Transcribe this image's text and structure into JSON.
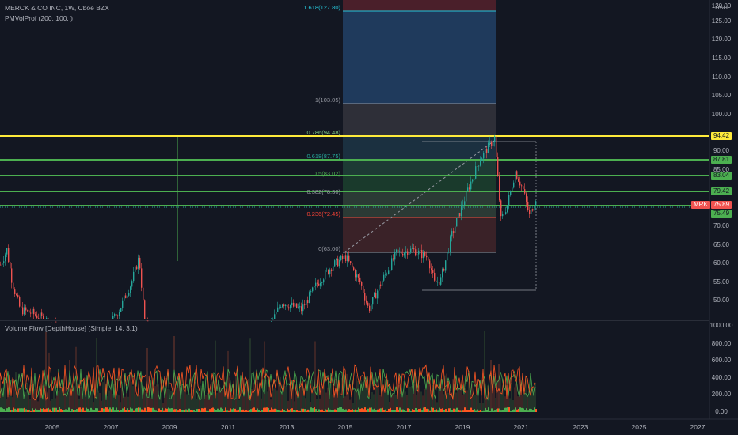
{
  "header": {
    "title": "MERCK & CO INC, 1W, Cboe BZX",
    "indicator": "PMVolProf (200, 100, )",
    "currency": "USD",
    "lower_indicator": "Volume Flow [DepthHouse] (Simple, 14, 3.1)"
  },
  "colors": {
    "background": "#131722",
    "up": "#26a69a",
    "down": "#ef5350",
    "yellow_line": "#ffeb3b",
    "green_line": "#4caf50"
  },
  "price_axis": [
    "120.00",
    "125.00",
    "115.00",
    "110.00",
    "105.00",
    "100.00",
    "90.00",
    "85.00",
    "70.00",
    "65.00",
    "60.00",
    "55.00",
    "50.00"
  ],
  "volume_axis": [
    "1000.00",
    "800.00",
    "600.00",
    "400.00",
    "200.00",
    "0.00"
  ],
  "time_axis": [
    "2005",
    "2007",
    "2009",
    "2011",
    "2013",
    "2015",
    "2017",
    "2019",
    "2021",
    "2023",
    "2025",
    "2027"
  ],
  "fib_levels": [
    {
      "label": "1.618(127.80)",
      "price": 127.8,
      "color": "#26c6da"
    },
    {
      "label": "1(103.05)",
      "price": 103.05,
      "color": "#9598a1"
    },
    {
      "label": "0.786(94.48)",
      "price": 94.48,
      "color": "#81c784"
    },
    {
      "label": "0.618(87.75)",
      "price": 87.75,
      "color": "#26a69a"
    },
    {
      "label": "0.5(83.02)",
      "price": 83.02,
      "color": "#4caf50"
    },
    {
      "label": "0.382(78.30)",
      "price": 78.3,
      "color": "#9598a1"
    },
    {
      "label": "0.236(72.45)",
      "price": 72.45,
      "color": "#f44336"
    },
    {
      "label": "0(63.00)",
      "price": 63.0,
      "color": "#9598a1"
    }
  ],
  "horizontal_lines": [
    {
      "price": 94.42,
      "label": "94.42",
      "color": "#ffeb3b"
    },
    {
      "price": 87.81,
      "label": "87.81",
      "color": "#4caf50"
    },
    {
      "price": 83.04,
      "label": "83.04",
      "color": "#4caf50"
    },
    {
      "price": 79.42,
      "label": "79.42",
      "color": "#4caf50"
    },
    {
      "price": 75.49,
      "label": "75.49",
      "color": "#4caf50"
    }
  ],
  "current_price": {
    "symbol": "MRK",
    "value": "75.89",
    "price": 75.89
  }
}
